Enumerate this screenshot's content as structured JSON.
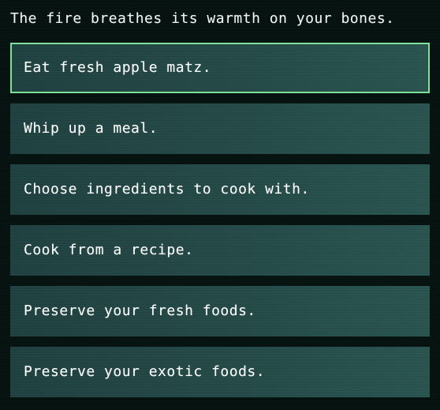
{
  "screen": {
    "background_color": "#05120f",
    "option_background_color": "#1f4442",
    "selected_border_color": "#7fdf9b",
    "text_color": "#ffffff"
  },
  "prompt": {
    "text": "The fire breathes its warmth on your bones."
  },
  "menu": {
    "selected_index": 0,
    "options": [
      {
        "label": "Eat fresh apple matz.",
        "selected": true
      },
      {
        "label": "Whip up a meal.",
        "selected": false
      },
      {
        "label": "Choose ingredients to cook with.",
        "selected": false
      },
      {
        "label": "Cook from a recipe.",
        "selected": false
      },
      {
        "label": "Preserve your fresh foods.",
        "selected": false
      },
      {
        "label": "Preserve your exotic foods.",
        "selected": false
      }
    ]
  }
}
